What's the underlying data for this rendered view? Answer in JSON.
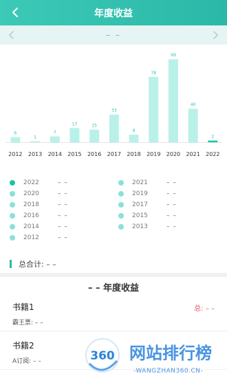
{
  "header": {
    "title": "年度收益"
  },
  "year_switch": {
    "value": "– –"
  },
  "chart_data": {
    "type": "bar",
    "categories": [
      "2012",
      "2013",
      "2014",
      "2015",
      "2016",
      "2017",
      "2018",
      "2019",
      "2020",
      "2021",
      "2022"
    ],
    "values": [
      6,
      1,
      7,
      17,
      15,
      33,
      9,
      78,
      99,
      40,
      2
    ],
    "value_labels": [
      "6",
      "1",
      "7",
      "17",
      "15",
      "33",
      "9",
      "78",
      "99",
      "40",
      "2"
    ],
    "highlighted": "2022",
    "ylim": [
      0,
      100
    ],
    "colors": {
      "bar": "#b9f1e8",
      "highlight": "#1cc3a6",
      "label": "#33bfa8"
    }
  },
  "legend": {
    "items": [
      {
        "year": "2022",
        "value": "– –",
        "active": true
      },
      {
        "year": "2021",
        "value": "– –"
      },
      {
        "year": "2020",
        "value": "– –"
      },
      {
        "year": "2019",
        "value": "– –"
      },
      {
        "year": "2018",
        "value": "– –"
      },
      {
        "year": "2017",
        "value": "– –"
      },
      {
        "year": "2016",
        "value": "– –"
      },
      {
        "year": "2015",
        "value": "– –"
      },
      {
        "year": "2014",
        "value": "– –"
      },
      {
        "year": "2013",
        "value": "– –"
      },
      {
        "year": "2012",
        "value": "– –"
      }
    ]
  },
  "total": {
    "label": "总合计: – –"
  },
  "section": {
    "title": "– –  年度收益"
  },
  "items": [
    {
      "name": "书籍1",
      "sub": "霸王票: – –",
      "sum": "总: – –"
    },
    {
      "name": "书籍2",
      "sub": "A订阅: – –",
      "sum": ""
    }
  ],
  "watermark": {
    "brand": "网站排行榜",
    "url": "-WANGZHAN360.CN-",
    "logo_text": "360"
  },
  "colors": {
    "accent": "#2bb8a8",
    "pink": "#e0566a"
  },
  "icons": {
    "back": "chevron-left-icon",
    "prev": "chevron-left-icon",
    "next": "chevron-right-icon"
  }
}
